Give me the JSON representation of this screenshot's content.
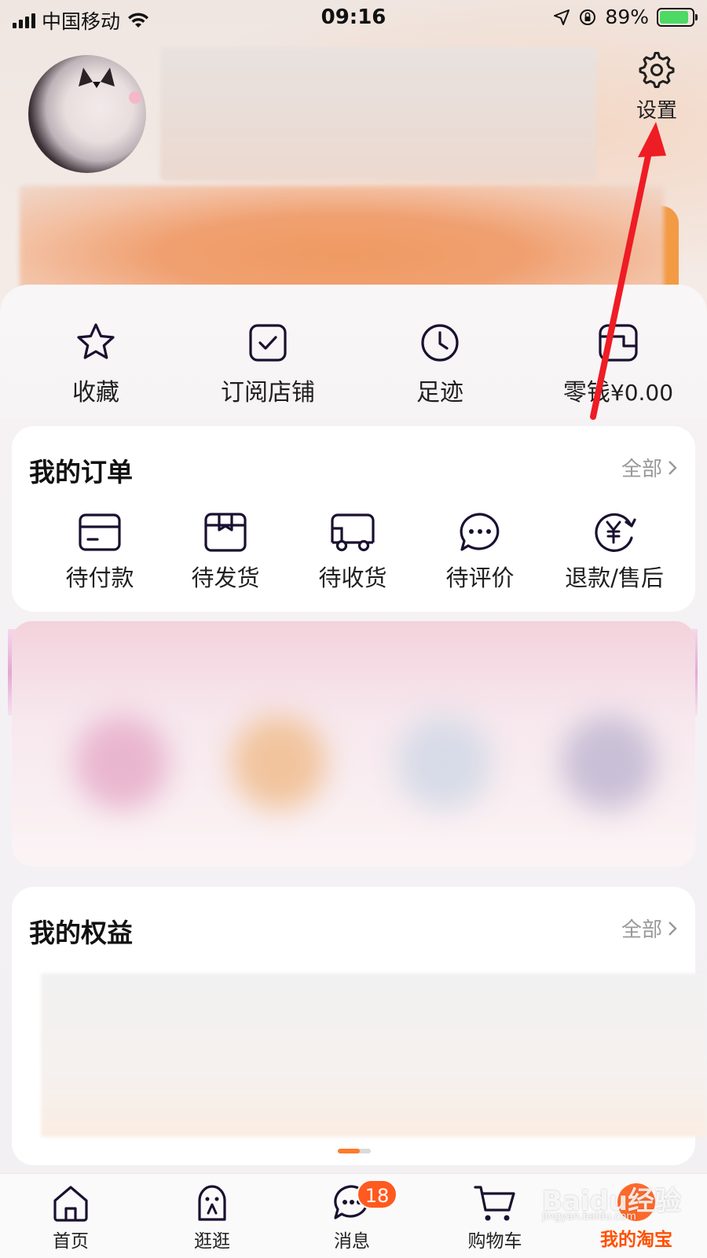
{
  "status_bar": {
    "carrier": "中国移动",
    "time": "09:16",
    "battery": "89%",
    "battery_level": 0.89
  },
  "header": {
    "settings_label": "设置",
    "settings_icon": "gear-icon"
  },
  "quick_links": [
    {
      "label": "收藏",
      "icon": "star-icon"
    },
    {
      "label": "订阅店铺",
      "icon": "check-box-icon"
    },
    {
      "label": "足迹",
      "icon": "clock-icon"
    },
    {
      "label": "零钱",
      "amount": "¥0.00",
      "icon": "wallet-icon"
    }
  ],
  "orders": {
    "title": "我的订单",
    "more": "全部",
    "items": [
      {
        "label": "待付款",
        "icon": "card-icon"
      },
      {
        "label": "待发货",
        "icon": "package-icon"
      },
      {
        "label": "待收货",
        "icon": "truck-icon"
      },
      {
        "label": "待评价",
        "icon": "chat-bubble-icon"
      },
      {
        "label": "退款/售后",
        "icon": "refund-icon"
      }
    ]
  },
  "benefits": {
    "title": "我的权益",
    "more": "全部"
  },
  "tab_bar": {
    "items": [
      {
        "label": "首页",
        "icon": "home-icon"
      },
      {
        "label": "逛逛",
        "icon": "browse-icon"
      },
      {
        "label": "消息",
        "icon": "message-icon",
        "badge": "18"
      },
      {
        "label": "购物车",
        "icon": "cart-icon"
      },
      {
        "label": "我的淘宝",
        "icon": "profile-icon",
        "active": true
      }
    ]
  },
  "watermark": {
    "text": "Baidu经验",
    "sub": "jingyan.baidu.com"
  },
  "colors": {
    "accent": "#ff5000",
    "annotation_arrow": "#ee1c25",
    "badge": "#ff5a1f"
  }
}
